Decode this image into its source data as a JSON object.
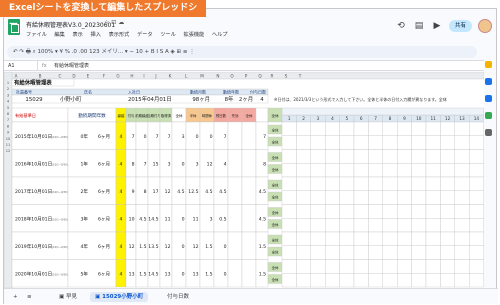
{
  "banner": "Excelシートを変換して編集したスプレッドシート",
  "doc": {
    "title": "有給休暇管理表V3.0_20230601",
    "title_icons": "☆ ⊡ ☁",
    "menu": [
      "ファイル",
      "編集",
      "表示",
      "挿入",
      "表示形式",
      "データ",
      "ツール",
      "拡張機能",
      "ヘルプ"
    ],
    "share_label": "共有",
    "toolbar_text": "↶ ↷ 🖶 ⌕  100% ▾  ¥  %  .0  .00  123  メイリ... ▾  −  10  +  B  I  S  A  ◈  ⊞  ≡  ⋮"
  },
  "formula_bar": {
    "cell_ref": "A1",
    "fx": "fx",
    "value": "有給休暇管理表"
  },
  "sheet": {
    "col_letters": [
      "A",
      "B",
      "C",
      "D",
      "E",
      "F",
      "G",
      "H",
      "I",
      "J",
      "K",
      "L",
      "M",
      "N",
      "O",
      "P",
      "Q",
      "R",
      "S",
      "T"
    ],
    "row_numbers": [
      "1",
      "2",
      "3",
      "4",
      "5",
      "6",
      "7",
      "8",
      "9",
      "10",
      "11",
      "12"
    ],
    "title": "有給休暇管理表",
    "employee_headers": [
      "社員番号",
      "氏名",
      "入社日",
      "勤続月数",
      "勤続年数",
      "付与日数"
    ],
    "employee": {
      "id": "15029",
      "name": "小野小町",
      "hire_date": "2015年04月01日",
      "months": "98ヶ月",
      "years": "8年",
      "years_months": "2ヶ月",
      "grant": "4"
    },
    "note": "※日付は、2021/3/3という形式で入力して下さい。全休と半休の日付入力欄が異なります。全休",
    "table_headers": [
      "有給基準日",
      "勤続期間年数",
      "繰越",
      "付与",
      "前期繰越",
      "当期付与",
      "取得済",
      "全休",
      "半休",
      "時間休",
      "残日数",
      "失効",
      "全休"
    ],
    "day_numbers": [
      "1",
      "2",
      "3",
      "4",
      "5",
      "6",
      "7",
      "8",
      "9",
      "10",
      "11",
      "12",
      "13",
      "14"
    ],
    "rows": [
      {
        "date": "2015年10月01日",
        "tail": "(10/1~9/30)",
        "yrs": "0年",
        "mon": "6ヶ月",
        "c": "4",
        "vals": [
          "7",
          "0",
          "7",
          "7",
          "3",
          "0",
          "0",
          "7"
        ],
        "end": "7"
      },
      {
        "date": "2016年10月01日",
        "tail": "(10/1~9/30)",
        "yrs": "1年",
        "mon": "6ヶ月",
        "c": "4",
        "vals": [
          "8",
          "7",
          "15",
          "3",
          "0",
          "3",
          "12",
          "4"
        ],
        "end": "8"
      },
      {
        "date": "2017年10月01日",
        "tail": "(10/1~9/30)",
        "yrs": "2年",
        "mon": "6ヶ月",
        "c": "4",
        "vals": [
          "9",
          "8",
          "17",
          "12",
          "4.5",
          "12.5",
          "4.5",
          "4.5"
        ],
        "end": "4.5"
      },
      {
        "date": "2018年10月01日",
        "tail": "(10/1~9/30)",
        "yrs": "3年",
        "mon": "6ヶ月",
        "c": "4",
        "vals": [
          "10",
          "4.5",
          "14.5",
          "11",
          "0",
          "11",
          "3",
          "0.5"
        ],
        "end": "4.5"
      },
      {
        "date": "2019年10月01日",
        "tail": "(10/1~9/30)",
        "yrs": "4年",
        "mon": "6ヶ月",
        "c": "4",
        "vals": [
          "12",
          "1.5",
          "13.5",
          "12",
          "0",
          "12",
          "1.5",
          "0"
        ],
        "end": "1.5"
      },
      {
        "date": "2020年10月01日",
        "tail": "(10/1~9/30)",
        "yrs": "5年",
        "mon": "6ヶ月",
        "c": "4",
        "vals": [
          "13",
          "1.5",
          "14.5",
          "13",
          "0",
          "13",
          "1.5",
          "0"
        ],
        "end": "1.5"
      }
    ],
    "badge": "全休"
  },
  "tabs": [
    {
      "label": "+"
    },
    {
      "label": "≡"
    },
    {
      "label": "▣ 早見"
    },
    {
      "label": "▣ 15029小野小町"
    },
    {
      "label": "付与日数"
    }
  ],
  "colors": {
    "yellow": "#fff200",
    "green": "#c9e0b4",
    "orange": "#f7c790",
    "salmon": "#f4a9a0",
    "header": "#e8ecef"
  }
}
